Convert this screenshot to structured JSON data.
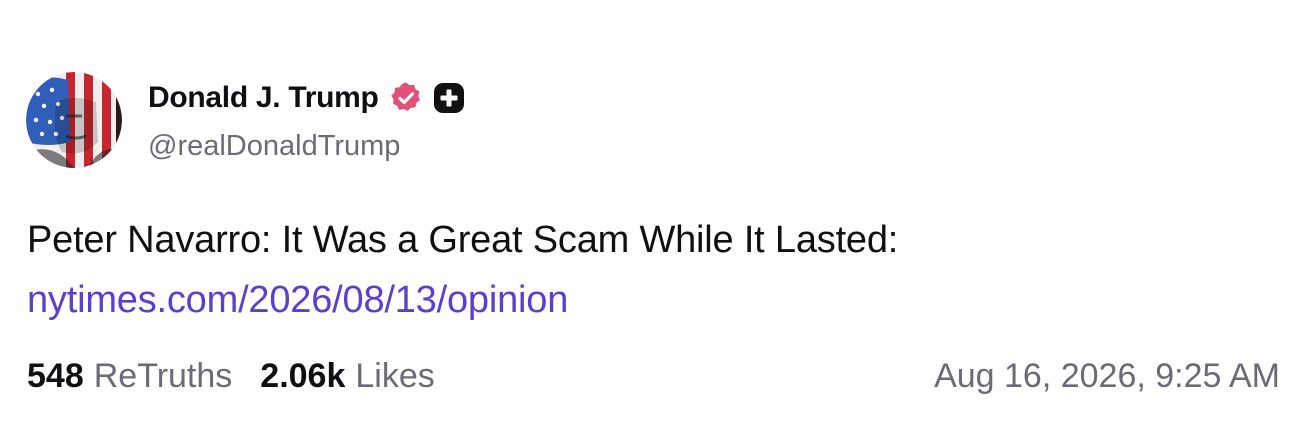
{
  "author": {
    "display_name": "Donald J. Trump",
    "handle": "@realDonaldTrump",
    "verified_badge_icon": "verified-badge-icon",
    "plus_badge_icon": "plus-badge-icon",
    "avatar_icon": "flag-portrait-avatar"
  },
  "post": {
    "text": "Peter Navarro: It Was a Great Scam While It Lasted:",
    "link": "nytimes.com/2026/08/13/opinion"
  },
  "stats": {
    "retruths_count": "548",
    "retruths_label": "ReTruths",
    "likes_count": "2.06k",
    "likes_label": "Likes"
  },
  "timestamp": "Aug 16, 2026, 9:25 AM",
  "colors": {
    "link": "#5a3fd0",
    "muted": "#6b6b78",
    "text": "#0f0f14",
    "verified_badge": "#e0507a"
  }
}
